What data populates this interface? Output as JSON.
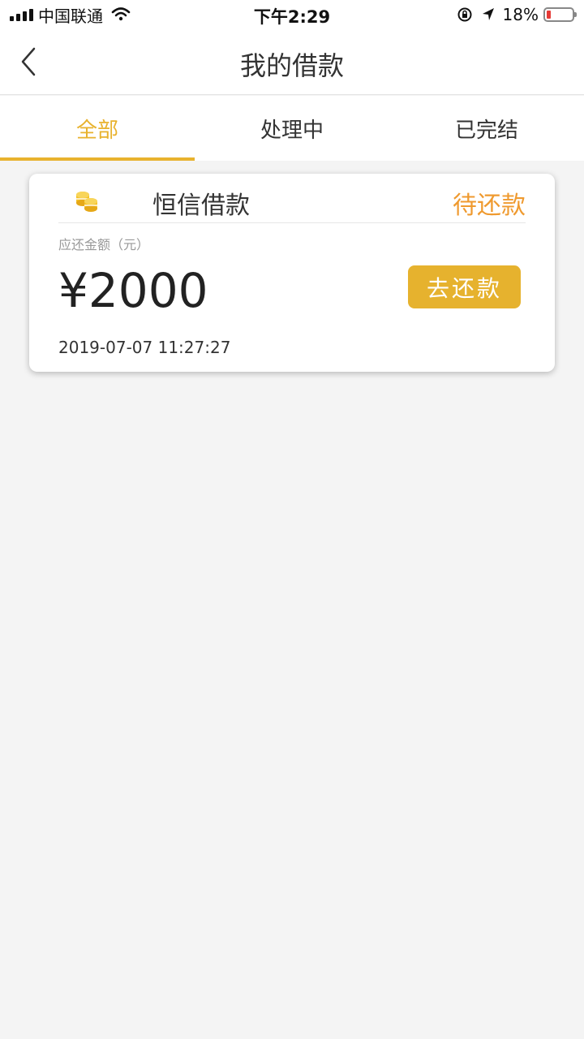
{
  "status_bar": {
    "carrier": "中国联通",
    "time": "下午2:29",
    "battery_percent": "18%",
    "battery_level": 0.18,
    "icons": [
      "signal-icon",
      "wifi-icon",
      "rotation-lock-icon",
      "location-arrow-icon",
      "battery-icon"
    ]
  },
  "nav": {
    "title": "我的借款",
    "back_icon": "chevron-left-icon"
  },
  "tabs": [
    {
      "label": "全部",
      "active": true
    },
    {
      "label": "处理中",
      "active": false
    },
    {
      "label": "已完结",
      "active": false
    }
  ],
  "loan": {
    "name": "恒信借款",
    "status": "待还款",
    "amount_label": "应还金额（元）",
    "amount": "¥2000",
    "repay_label": "去还款",
    "date": "2019-07-07 11:27:27",
    "icon": "coins-icon"
  },
  "colors": {
    "accent": "#e8b22e",
    "status": "#ef9a2f",
    "background": "#f4f4f4"
  }
}
